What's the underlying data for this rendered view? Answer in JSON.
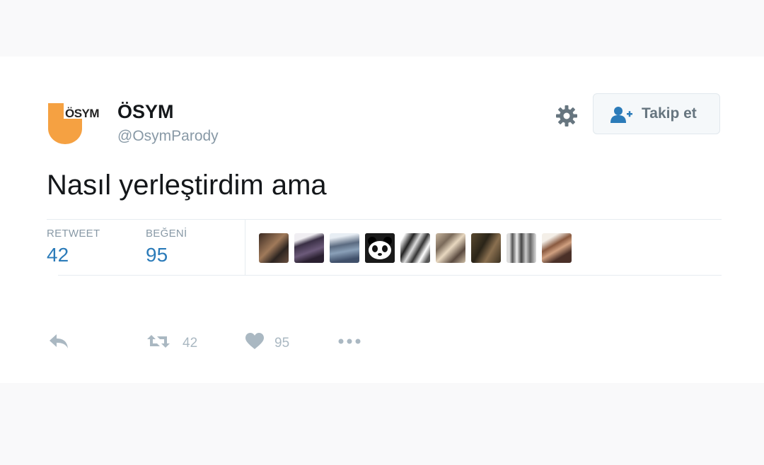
{
  "user": {
    "logo_text": "ÖSYM",
    "display_name": "ÖSYM",
    "handle": "@OsymParody"
  },
  "follow_button": {
    "label": "Takip et",
    "icon": "add-user-icon"
  },
  "settings_icon": "gear-icon",
  "tweet": {
    "text": "Nasıl yerleştirdim ama"
  },
  "stats": {
    "retweet_label": "RETWEET",
    "retweet_count": "42",
    "like_label": "BEĞENİ",
    "like_count": "95"
  },
  "likers": [
    {
      "name": "liker-avatar"
    },
    {
      "name": "liker-avatar"
    },
    {
      "name": "liker-avatar"
    },
    {
      "name": "liker-avatar-panda"
    },
    {
      "name": "liker-avatar"
    },
    {
      "name": "liker-avatar"
    },
    {
      "name": "liker-avatar"
    },
    {
      "name": "liker-avatar"
    },
    {
      "name": "liker-avatar"
    }
  ],
  "actions": {
    "reply_icon": "reply-icon",
    "retweet_count": "42",
    "like_count": "95",
    "more_icon": "more-icon"
  },
  "colors": {
    "logo_orange": "#f5a142",
    "link_blue": "#2b7bb9",
    "muted": "#8899a6",
    "action_gray": "#aab8c2"
  }
}
